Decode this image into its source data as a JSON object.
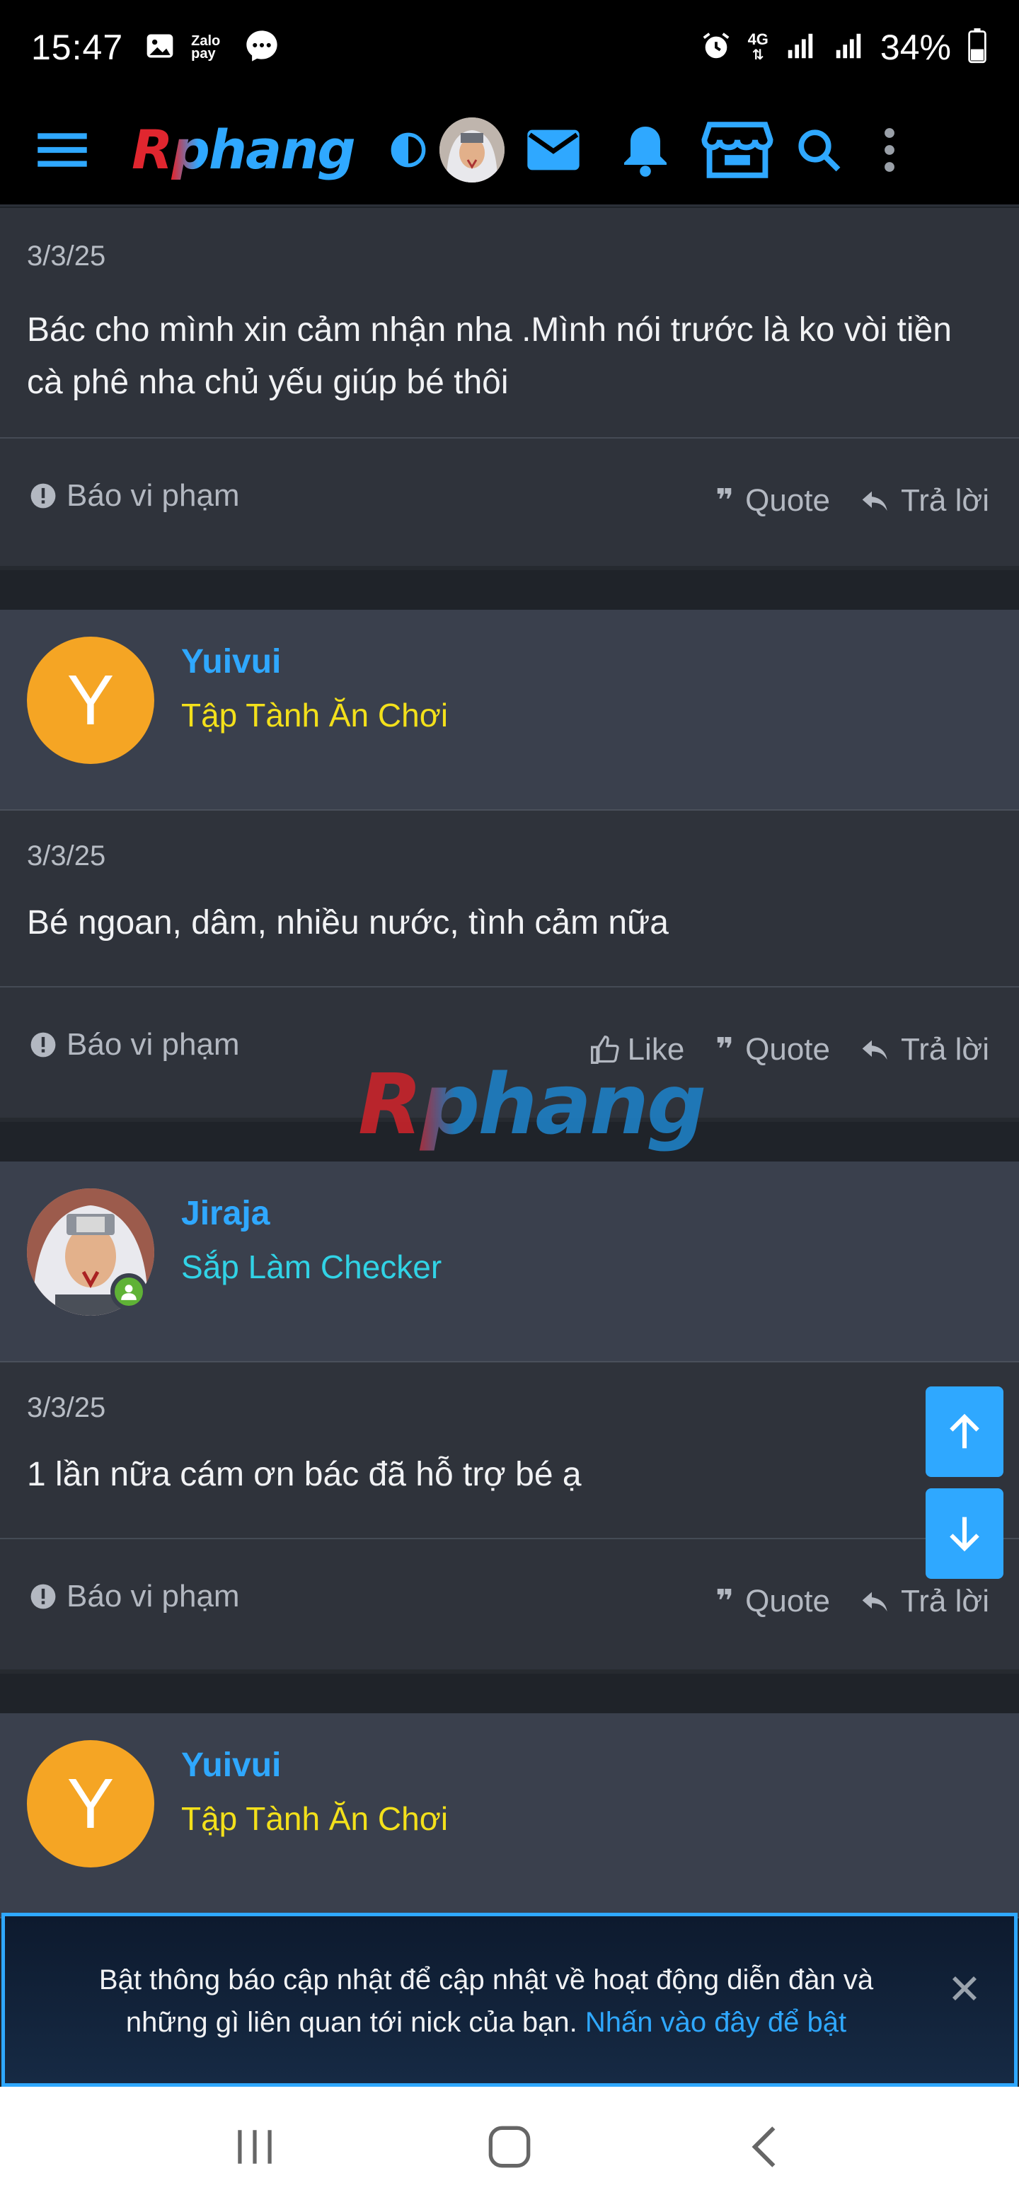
{
  "status_bar": {
    "time": "15:47",
    "battery": "34%",
    "left_icons": [
      "gallery-icon",
      "zalopay-icon",
      "messenger-icon"
    ],
    "zalopay_label": "Zalo pay",
    "right_icons": [
      "alarm-icon",
      "4g-data-icon",
      "signal-icon",
      "signal-icon",
      "battery-icon"
    ],
    "network": "4G"
  },
  "header": {
    "logo": "Rphang",
    "icons": [
      "menu-icon",
      "theme-toggle-icon",
      "user-avatar",
      "mail-icon",
      "bell-icon",
      "store-icon",
      "search-icon",
      "more-vert-icon"
    ]
  },
  "posts": [
    {
      "date": "3/3/25",
      "text": "Bác cho mình xin cảm nhận nha .Mình nói trước là ko vòi tiền cà phê nha chủ yếu giúp bé thôi",
      "report_label": "Báo vi phạm",
      "quote_label": "Quote",
      "reply_label": "Trả lời"
    },
    {
      "user": {
        "initial": "Y",
        "name": "Yuivui",
        "title": "Tập Tành Ăn Chơi",
        "title_color": "#f3e01b"
      },
      "date": "3/3/25",
      "text": "Bé ngoan, dâm, nhiều nước, tình cảm nữa",
      "report_label": "Báo vi phạm",
      "like_label": "Like",
      "quote_label": "Quote",
      "reply_label": "Trả lời"
    },
    {
      "user": {
        "name": "Jiraja",
        "title": "Sắp Làm Checker",
        "title_color": "#31d3e6",
        "online": true
      },
      "date": "3/3/25",
      "text": "1 lần nữa cám ơn bác đã hỗ trợ bé ạ",
      "report_label": "Báo vi phạm",
      "quote_label": "Quote",
      "reply_label": "Trả lời"
    },
    {
      "user": {
        "initial": "Y",
        "name": "Yuivui",
        "title": "Tập Tành Ăn Chơi",
        "title_color": "#f3e01b"
      }
    }
  ],
  "watermark": "Rphang",
  "notification": {
    "text": "Bật thông báo cập nhật để cập nhật về hoạt động diễn đàn và những gì liên quan tới nick của bạn.",
    "link": "Nhấn vào đây để bật"
  },
  "colors": {
    "accent": "#2fa8ff",
    "background": "#2f333b",
    "user_card": "#3a404d"
  }
}
